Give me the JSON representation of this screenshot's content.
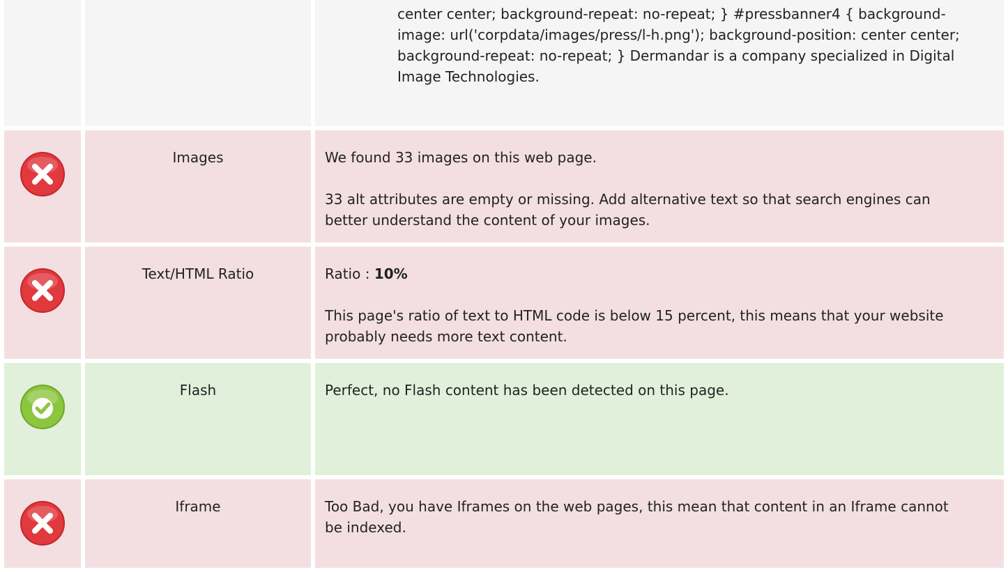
{
  "rows": {
    "top": {
      "content": "center center; background-repeat: no-repeat; } #pressbanner4 { background-image: url('corpdata/images/press/l-h.png'); background-position: center center; background-repeat: no-repeat; } Dermandar is a company specialized in Digital Image Technologies."
    },
    "images": {
      "label": "Images",
      "status_icon": "error-x-icon",
      "line1": "We found 33 images on this web page.",
      "line2": "33 alt attributes are empty or missing. Add alternative text so that search engines can better understand the content of your images."
    },
    "ratio": {
      "label": "Text/HTML Ratio",
      "status_icon": "error-x-icon",
      "prefix": "Ratio : ",
      "value": "10%",
      "line2": "This page's ratio of text to HTML code is below 15 percent, this means that your website probably needs more text content."
    },
    "flash": {
      "label": "Flash",
      "status_icon": "check-icon",
      "line1": "Perfect, no Flash content has been detected on this page."
    },
    "iframe": {
      "label": "Iframe",
      "status_icon": "error-x-icon",
      "line1": "Too Bad, you have Iframes on the web pages, this mean that content in an Iframe cannot be indexed."
    }
  },
  "colors": {
    "error_row_bg": "#f3dfe1",
    "success_row_bg": "#e0f0da",
    "neutral_row_bg": "#f5f5f5",
    "error_icon": "#e0393e",
    "success_icon": "#8cc63f"
  }
}
